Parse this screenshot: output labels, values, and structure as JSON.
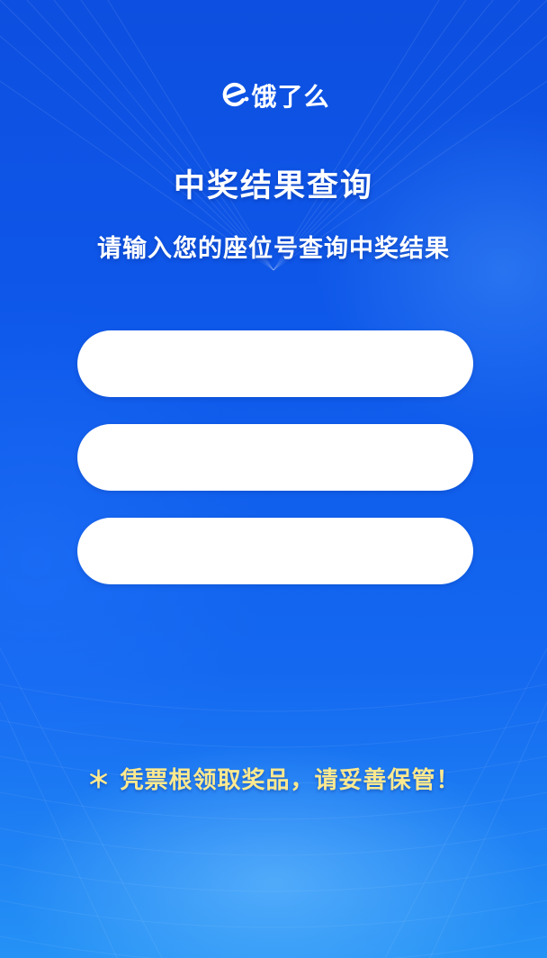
{
  "brand": {
    "logo_text": "饿了么",
    "logo_icon": "eleme-e-icon"
  },
  "header": {
    "title": "中奖结果查询",
    "subtitle": "请输入您的座位号查询中奖结果"
  },
  "form": {
    "fields": [
      {
        "value": "",
        "placeholder": ""
      },
      {
        "value": "",
        "placeholder": ""
      },
      {
        "value": "",
        "placeholder": ""
      }
    ]
  },
  "footer": {
    "notice": "＊ 凭票根领取奖品，请妥善保管！"
  },
  "colors": {
    "background_top": "#0d4fe0",
    "background_bottom": "#2592f6",
    "field_bg": "#ffffff",
    "notice_text": "#fde98e",
    "title_text": "#ffffff"
  }
}
